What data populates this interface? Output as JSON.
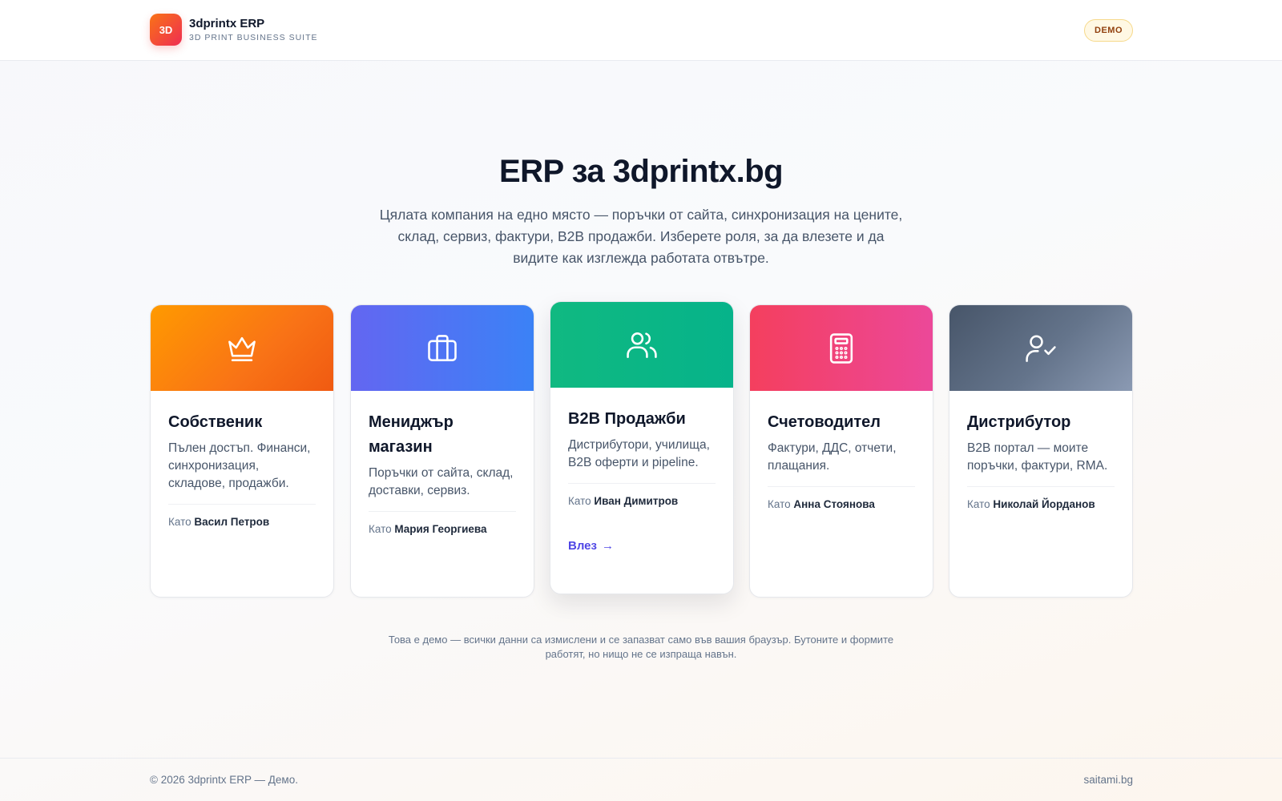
{
  "header": {
    "logo_text": "3D",
    "app_name": "3dprintx ERP",
    "app_subtitle": "3D PRINT BUSINESS SUITE",
    "badge": "DEMO"
  },
  "hero": {
    "title": "ERP за 3dprintx.bg",
    "description": "Цялата компания на едно място — поръчки от сайта, синхронизация на цените, склад, сервиз, фактури, B2B продажби. Изберете роля, за да влезете и да видите как изглежда работата отвътре."
  },
  "roles": [
    {
      "title": "Собственик",
      "description": "Пълен достъп. Финанси, синхронизация, складове, продажби.",
      "as_label": "Като",
      "user": "Васил Петров",
      "icon": "crown-icon",
      "color": "#f97316"
    },
    {
      "title": "Мениджър магазин",
      "description": "Поръчки от сайта, склад, доставки, сервиз.",
      "as_label": "Като",
      "user": "Мария Георгиева",
      "icon": "briefcase-icon",
      "color": "#4f6ef5"
    },
    {
      "title": "B2B Продажби",
      "description": "Дистрибутори, училища, B2B оферти и pipeline.",
      "as_label": "Като",
      "user": "Иван Димитров",
      "icon": "users-icon",
      "color": "#10b981",
      "enter_label": "Влез",
      "enter_arrow": "→"
    },
    {
      "title": "Счетоводител",
      "description": "Фактури, ДДС, отчети, плащания.",
      "as_label": "Като",
      "user": "Анна Стоянова",
      "icon": "calculator-icon",
      "color": "#f43f5e"
    },
    {
      "title": "Дистрибутор",
      "description": "B2B портал — моите поръчки, фактури, RMA.",
      "as_label": "Като",
      "user": "Николай Йорданов",
      "icon": "user-check-icon",
      "color": "#64748b"
    }
  ],
  "notice": "Това е демо — всички данни са измислени и се запазват само във вашия браузър. Бутоните и формите работят, но нищо не се изпраща навън.",
  "footer": {
    "copyright": "© 2026 3dprintx ERP — Демо.",
    "site": "saitami.bg"
  }
}
